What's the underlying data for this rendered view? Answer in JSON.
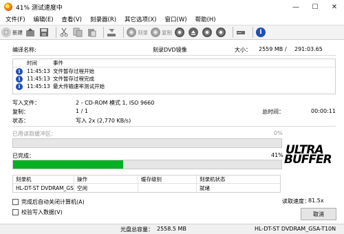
{
  "window": {
    "title": "41% 测试速度中",
    "minimize": "—",
    "maximize": "☐",
    "close": "✕"
  },
  "menu": [
    "文件(F)",
    "编辑(E)",
    "查看(V)",
    "刻录器(R)",
    "其它选项(X)",
    "窗口(W)",
    "帮助(H)"
  ],
  "toolbar": {
    "new_label": "新建",
    "burn_label": "刻录",
    "copy_label": "复制"
  },
  "info": {
    "compile_name_label": "编译名称:",
    "compile_name_value": "刻录DVD镜像",
    "size_label": "大小：",
    "size_value": "2559 MB",
    "size_sep": "/",
    "size_time": "291:03.65"
  },
  "log": {
    "col_time": "时间",
    "col_event": "事件",
    "rows": [
      {
        "time": "11:45:13",
        "event": "文件暂存过程开始"
      },
      {
        "time": "11:45:13",
        "event": "文件暂存过程完成"
      },
      {
        "time": "11:45:13",
        "event": "最大传输速率测试开始"
      }
    ]
  },
  "details": {
    "write_file_label": "写入文件：",
    "write_file_value": "2 - CD-ROM 模式 1, ISO 9660",
    "copies_label": "复制：",
    "copies_value": "1 / 1",
    "total_time_label": "总时间：",
    "total_time_value": "00:00:11",
    "status_label": "状态：",
    "status_value": "写入 2x (2,770 KB/s)"
  },
  "buffer": {
    "label": "已用读取缓冲区：",
    "percent_text": "0%",
    "fraction": 0.0
  },
  "progress": {
    "label": "已完成：",
    "percent_text": "41%",
    "fraction": 0.41
  },
  "logo": {
    "line1": "ULTRA",
    "line2": "BUFFER"
  },
  "devices": {
    "col_recorder": "刻录机",
    "col_action": "操作",
    "col_buffer": "缓存级别",
    "col_status": "刻录机状态",
    "rows": [
      {
        "recorder": "HL-DT-ST DVDRAM_GS...",
        "action": "空闲",
        "buffer": "",
        "status": "就绪"
      }
    ]
  },
  "options": {
    "shutdown_label": "完成后自动关闭计算机(A)",
    "verify_label": "校验写入数据(V)"
  },
  "read_speed": {
    "label": "读取速度：",
    "value": "81.5x"
  },
  "cancel_label": "取消",
  "statusbar": {
    "disc_total_label": "光盘总容量：",
    "disc_total_value": "2558.5 MB",
    "drive": "HL-DT-ST DVDRAM_GSA-T10N"
  },
  "colors": {
    "progress": "#06b025",
    "info_icon": "#1e4fb6"
  }
}
